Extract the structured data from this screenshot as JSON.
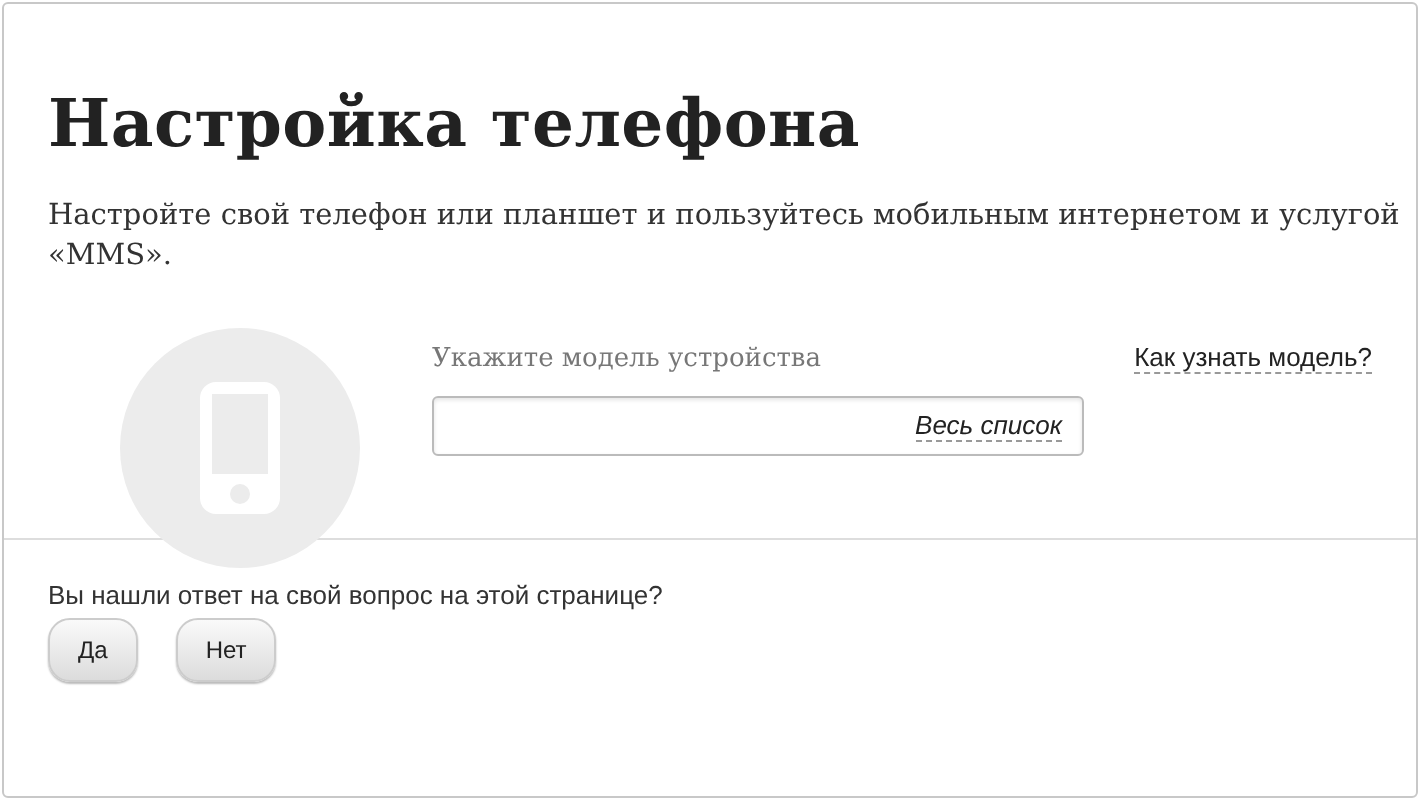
{
  "title": "Настройка телефона",
  "description": "Настройте свой телефон или планшет и пользуйтесь мобильным интернетом и услугой «MMS».",
  "device_search": {
    "label": "Укажите модель устройства",
    "list_link": "Весь список",
    "help_link": "Как узнать модель?"
  },
  "feedback": {
    "question": "Вы нашли ответ на свой вопрос на этой странице?",
    "buttons": [
      "Да",
      "Нет"
    ]
  }
}
